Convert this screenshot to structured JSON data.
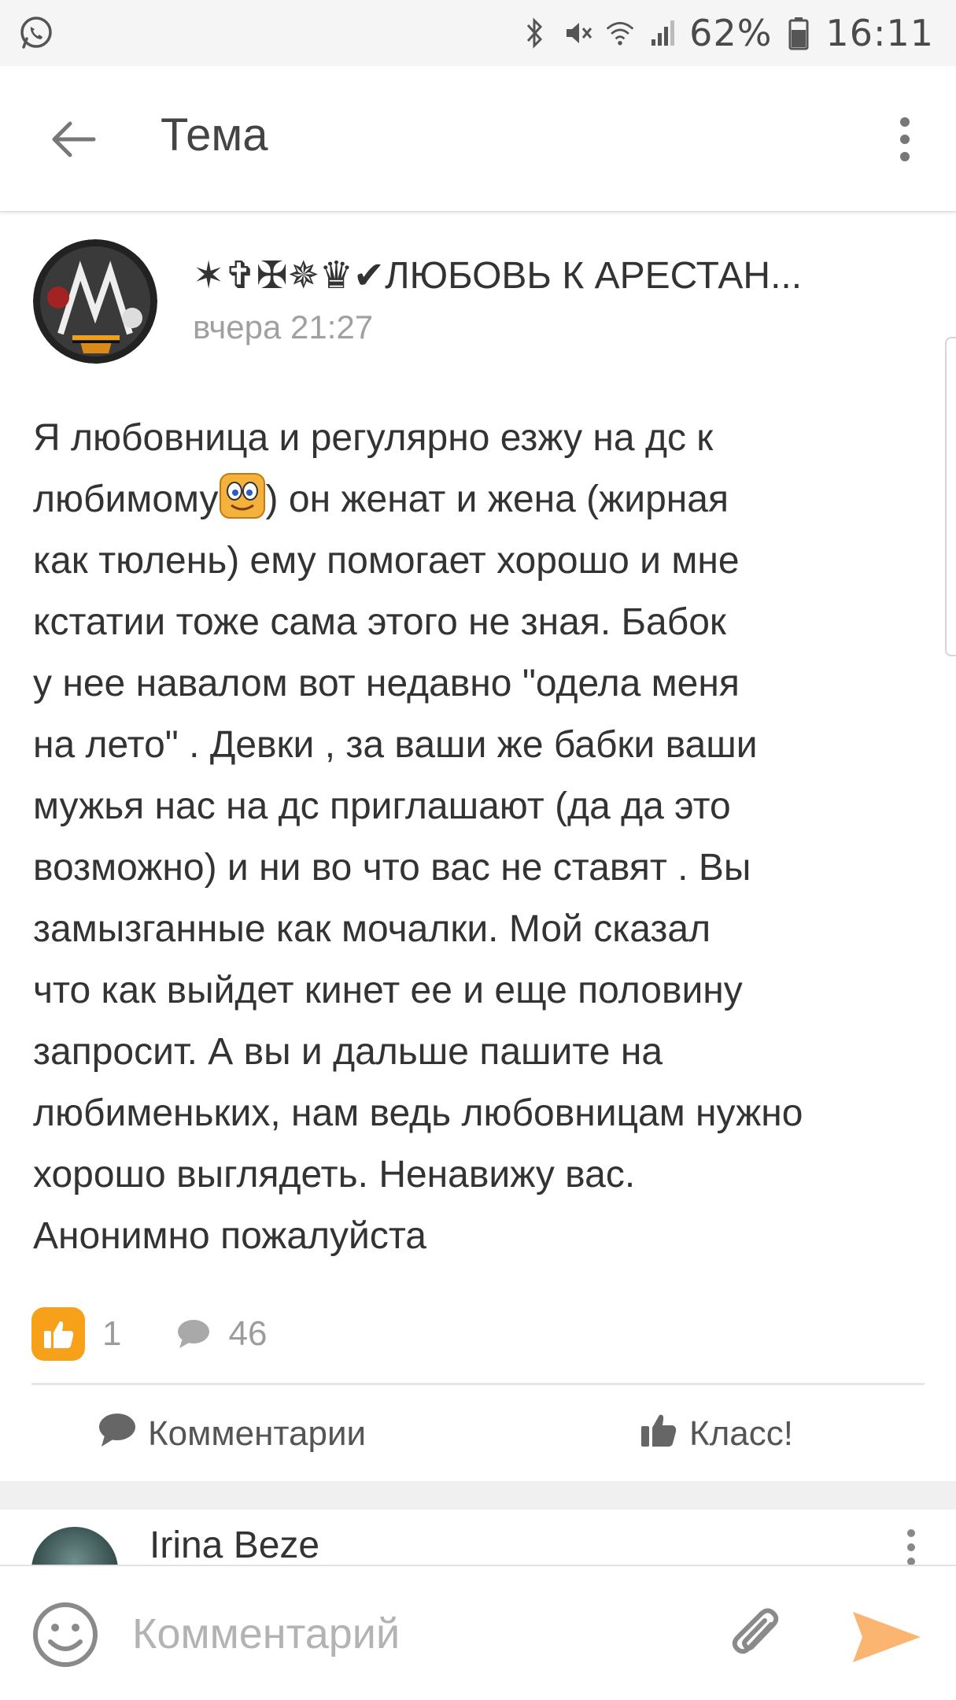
{
  "status_bar": {
    "battery_percent": "62%",
    "time": "16:11",
    "icons": [
      "whatsapp-icon",
      "bluetooth-icon",
      "mute-icon",
      "wifi-icon",
      "signal-icon",
      "battery-icon"
    ]
  },
  "toolbar": {
    "title": "Тема",
    "back_icon": "arrow-left-icon",
    "more_icon": "more-vertical-icon"
  },
  "post": {
    "group_name": "✶✞✠✵♛✔ЛЮБОВЬ К АРЕСТАН...",
    "time": "вчера 21:27",
    "text_lines": [
      "Я любовница и регулярно езжу на дс к",
      "любимому",
      ") он женат и жена (жирная",
      "как тюлень) ему помогает хорошо и мне",
      "кстатии тоже сама этого не зная. Бабок",
      "у нее навалом вот недавно \"одела меня",
      "на лето\" . Девки , за ваши же бабки ваши",
      "мужья нас на дс приглашают (да да это",
      "возможно) и ни во что вас не ставят . Вы",
      "замызганные как мочалки. Мой сказал",
      "что как выйдет кинет ее и еще половину",
      "запросит. А вы и дальше пашите на",
      "любименьких, нам ведь любовницам нужно",
      "хорошо выглядеть. Ненавижу вас.",
      "Анонимно пожалуйста"
    ],
    "likes_count": "1",
    "comments_count": "46"
  },
  "actions": {
    "comments_label": "Комментарии",
    "class_label": "Класс!"
  },
  "comment_preview": {
    "author": "Irina Beze"
  },
  "composer": {
    "placeholder": "Комментарий"
  },
  "colors": {
    "accent_orange": "#f7a11a",
    "send_orange": "#fbb571",
    "text_dark": "#333333",
    "text_muted": "#a0a0a0"
  }
}
